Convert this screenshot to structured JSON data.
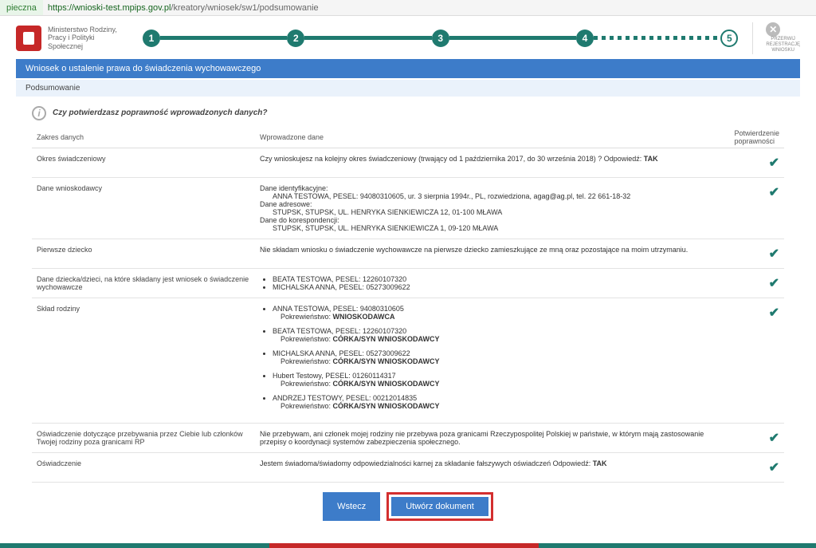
{
  "url": {
    "secure_label": "pieczna",
    "domain": "https://wnioski-test.mpips.gov.pl",
    "path": "/kreatory/wniosek/sw1/podsumowanie"
  },
  "logo": {
    "line1": "Ministerstwo Rodziny,",
    "line2": "Pracy i Polityki Społecznej"
  },
  "stepper": {
    "s1": "1",
    "s2": "2",
    "s3": "3",
    "s4": "4",
    "s5": "5"
  },
  "cancel_btn": {
    "line1": "PRZERWIJ",
    "line2": "REJESTRACJĘ",
    "line3": "WNIOSKU"
  },
  "title": "Wniosek o ustalenie prawa do świadczenia wychowawczego",
  "subtitle": "Podsumowanie",
  "confirm_question": "Czy potwierdzasz poprawność wprowadzonych danych?",
  "headers": {
    "range": "Zakres danych",
    "data": "Wprowadzone dane",
    "confirm": "Potwierdzenie poprawności"
  },
  "rows": {
    "okres": {
      "label": "Okres świadczeniowy",
      "text": "Czy wnioskujesz na kolejny okres świadczeniowy (trwający od 1 października 2017, do 30 września 2018) ? Odpowiedź: ",
      "answer": "TAK"
    },
    "wniosk": {
      "label": "Dane wnioskodawcy",
      "ident_h": "Dane identyfikacyjne:",
      "ident_v": "ANNA TESTOWA, PESEL: 94080310605, ur. 3 sierpnia 1994r., PL, rozwiedziona, agag@ag.pl, tel. 22 661-18-32",
      "addr_h": "Dane adresowe:",
      "addr_v": "STUPSK, STUPSK, UL. HENRYKA SIENKIEWICZA 12, 01-100 MŁAWA",
      "corr_h": "Dane do korespondencji:",
      "corr_v": "STUPSK, STUPSK, UL. HENRYKA SIENKIEWICZA 1, 09-120 MŁAWA"
    },
    "pierwsze": {
      "label": "Pierwsze dziecko",
      "text": "Nie składam wniosku o świadczenie wychowawcze na pierwsze dziecko zamieszkujące ze mną oraz pozostające na moim utrzymaniu."
    },
    "dzieci": {
      "label": "Dane dziecka/dzieci, na które składany jest wniosek o świadczenie wychowawcze",
      "i1": "BEATA TESTOWA, PESEL: 12260107320",
      "i2": "MICHALSKA ANNA, PESEL: 05273009622"
    },
    "sklad": {
      "label": "Skład rodziny",
      "rel_label": "Pokrewieństwo: ",
      "m1_name": "ANNA TESTOWA, PESEL: 94080310605",
      "m1_rel": "WNIOSKODAWCA",
      "m2_name": "BEATA TESTOWA, PESEL: 12260107320",
      "m2_rel": "CÓRKA/SYN WNIOSKODAWCY",
      "m3_name": "MICHALSKA ANNA, PESEL: 05273009622",
      "m3_rel": "CÓRKA/SYN WNIOSKODAWCY",
      "m4_name": "Hubert Testowy, PESEL: 01260114317",
      "m4_rel": "CÓRKA/SYN WNIOSKODAWCY",
      "m5_name": "ANDRZEJ TESTOWY, PESEL: 00212014835",
      "m5_rel": "CÓRKA/SYN WNIOSKODAWCY"
    },
    "oswRP": {
      "label": "Oświadczenie dotyczące przebywania przez Ciebie lub członków Twojej rodziny poza granicami RP",
      "text": "Nie przebywam, ani członek mojej rodziny nie przebywa poza granicami Rzeczypospolitej Polskiej w państwie, w którym mają zastosowanie przepisy o koordynacji systemów zabezpieczenia społecznego."
    },
    "osw": {
      "label": "Oświadczenie",
      "text": "Jestem świadoma/świadomy odpowiedzialności karnej za składanie fałszywych oświadczeń Odpowiedź: ",
      "answer": "TAK"
    }
  },
  "buttons": {
    "back": "Wstecz",
    "create": "Utwórz dokument"
  }
}
